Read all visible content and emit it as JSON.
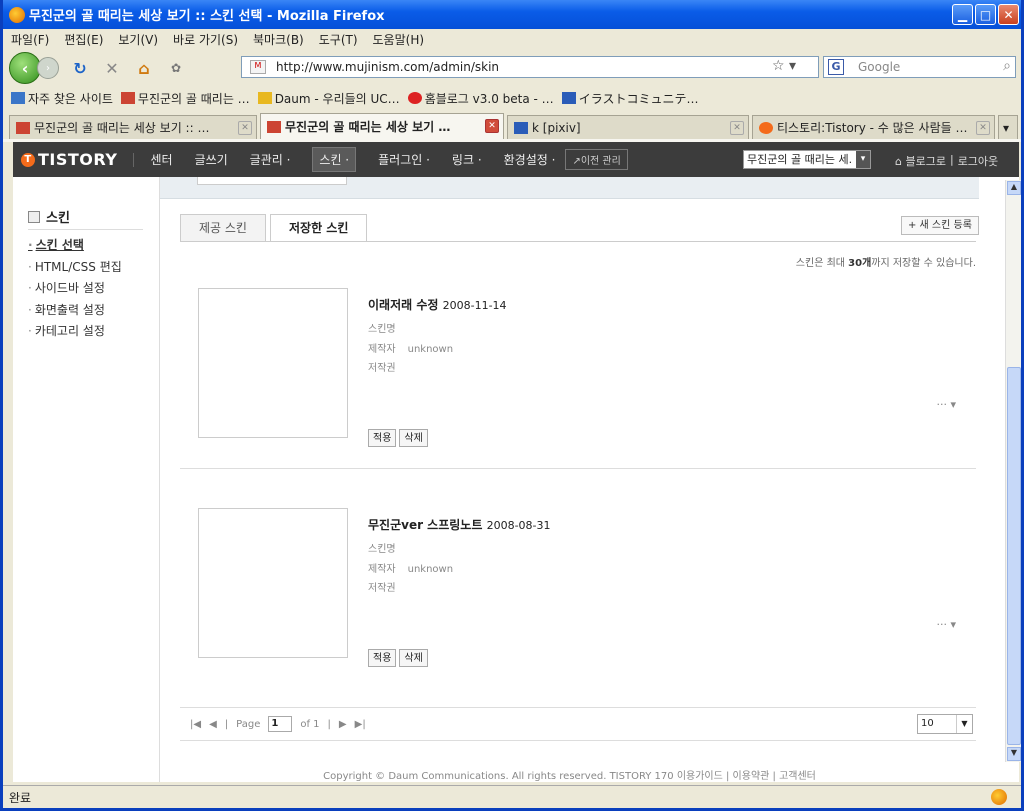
{
  "window": {
    "title": "무진군의 골 때리는 세상 보기 :: 스킨 선택 - Mozilla Firefox"
  },
  "menu": [
    "파일(F)",
    "편집(E)",
    "보기(V)",
    "바로 가기(S)",
    "북마크(B)",
    "도구(T)",
    "도움말(H)"
  ],
  "nav": {
    "url": "http://www.mujinism.com/admin/skin",
    "search_placeholder": "Google"
  },
  "bookmarks": [
    "자주 찾은 사이트",
    "무진군의 골 때리는 …",
    "Daum - 우리들의 UC…",
    "홈블로그 v3.0 beta - …",
    "イラストコミュニテ…"
  ],
  "tabs": [
    {
      "label": "무진군의 골 때리는 세상 보기 :: …"
    },
    {
      "label": "무진군의 골 때리는 세상 보기 …"
    },
    {
      "label": "k [pixiv]"
    },
    {
      "label": "티스토리:Tistory - 수 많은 사람들 …"
    }
  ],
  "tistory": {
    "logo": "TISTORY",
    "menu": [
      "센터",
      "글쓰기",
      "글관리 ·",
      "스킨 ·",
      "플러그인 ·",
      "링크 ·",
      "환경설정 ·"
    ],
    "prev_admin": "↗이전 관리",
    "blog_select": "무진군의 골 때리는 세.",
    "to_blog": "⌂ 블로그로",
    "logout": "로그아웃"
  },
  "sidebar": {
    "title": "스킨",
    "items": [
      "스킨 선택",
      "HTML/CSS 편집",
      "사이드바 설정",
      "화면출력 설정",
      "카테고리 설정"
    ]
  },
  "skin_tabs": [
    "제공 스킨",
    "저장한 스킨"
  ],
  "new_skin_button": "+ 새 스킨 등록",
  "note": {
    "pre": "스킨은 최대 ",
    "num": "30개",
    "post": "까지 저장할 수 있습니다."
  },
  "skins": [
    {
      "name": "이래저래 수정",
      "date": "2008-11-14",
      "labels": [
        "스킨명",
        "제작자",
        "저작권"
      ],
      "author": "unknown",
      "more": "··· ▾",
      "apply": "적용",
      "delete": "삭제"
    },
    {
      "name": "무진군ver 스프링노트",
      "date": "2008-08-31",
      "labels": [
        "스킨명",
        "제작자",
        "저작권"
      ],
      "author": "unknown",
      "more": "··· ▾",
      "apply": "적용",
      "delete": "삭제"
    }
  ],
  "pager": {
    "page_label": "Page",
    "page": "1",
    "of": "of 1",
    "per_page": "10"
  },
  "footer": "Copyright © Daum Communications. All rights reserved. TISTORY 170  이용가이드 | 이용약관 | 고객센터",
  "status": "완료"
}
